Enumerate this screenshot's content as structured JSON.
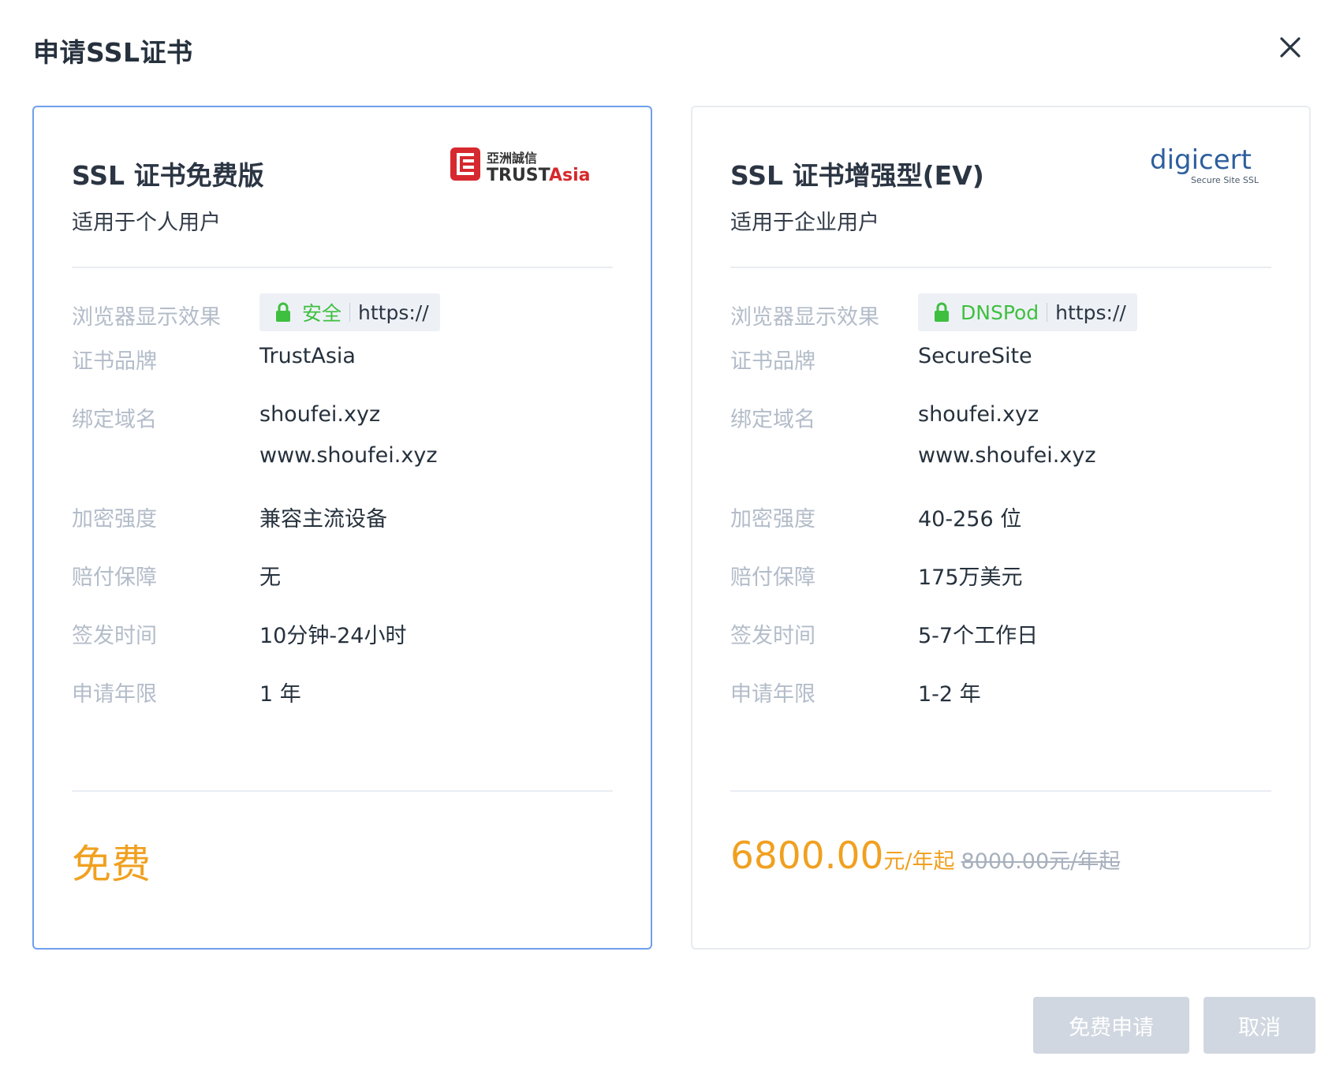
{
  "dialog": {
    "title": "申请SSL证书",
    "close_icon": "close-icon"
  },
  "cards": {
    "free": {
      "selected": true,
      "name": "SSL 证书免费版",
      "subtitle": "适用于个人用户",
      "logo": {
        "name": "trustasia-logo",
        "cn_text": "亞洲誠信",
        "en_text_a": "TRUST",
        "en_text_b": "Asia"
      },
      "browser_label": "浏览器显示效果",
      "browser_secure": "安全",
      "browser_https": "https://",
      "brand_label": "证书品牌",
      "brand_value": "TrustAsia",
      "domain_label": "绑定域名",
      "domains": [
        "shoufei.xyz",
        "www.shoufei.xyz"
      ],
      "encryption_label": "加密强度",
      "encryption_value": "兼容主流设备",
      "warranty_label": "赔付保障",
      "warranty_value": "无",
      "issue_label": "签发时间",
      "issue_value": "10分钟-24小时",
      "years_label": "申请年限",
      "years_value": "1 年",
      "price": "免费"
    },
    "ev": {
      "selected": false,
      "name": "SSL 证书增强型(EV)",
      "subtitle": "适用于企业用户",
      "logo": {
        "name": "digicert-logo",
        "text": "digicert",
        "sub_text": "Secure Site SSL"
      },
      "browser_label": "浏览器显示效果",
      "browser_secure": "DNSPod",
      "browser_https": "https://",
      "brand_label": "证书品牌",
      "brand_value": "SecureSite",
      "domain_label": "绑定域名",
      "domains": [
        "shoufei.xyz",
        "www.shoufei.xyz"
      ],
      "encryption_label": "加密强度",
      "encryption_value": "40-256 位",
      "warranty_label": "赔付保障",
      "warranty_value": "175万美元",
      "issue_label": "签发时间",
      "issue_value": "5-7个工作日",
      "years_label": "申请年限",
      "years_value": "1-2 年",
      "price": "6800.00",
      "price_unit": "元/年起",
      "price_original": "8000.00元/年起"
    }
  },
  "footer": {
    "apply_label": "免费申请",
    "cancel_label": "取消"
  },
  "colors": {
    "accent_price": "#f0a020",
    "selected_border": "#6ea0ec",
    "secure_green": "#3fbf3f",
    "muted_label": "#b3bcc9",
    "disabled_button": "#d0d7e0"
  }
}
